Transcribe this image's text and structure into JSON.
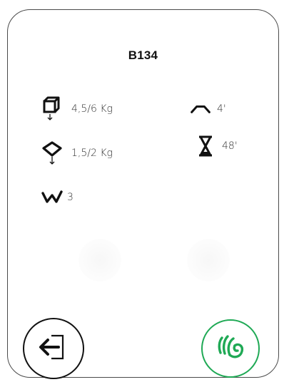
{
  "program": {
    "title": "B134"
  },
  "specs": {
    "dry_load": "4,5/6 Kg",
    "synthetic_load": "1,5/2 Kg",
    "wash_level": "3",
    "spin_time": "4'",
    "cycle_time": "48'"
  },
  "icons": {
    "dry_load": "cube-weight-icon",
    "synthetic_load": "diamond-weight-icon",
    "wash_level": "wave-level-icon",
    "spin_time": "arch-icon",
    "cycle_time": "hourglass-icon",
    "back": "exit-door-icon",
    "start": "hand-touch-icon"
  },
  "colors": {
    "start_accent": "#1fa955",
    "outline": "#111111"
  }
}
